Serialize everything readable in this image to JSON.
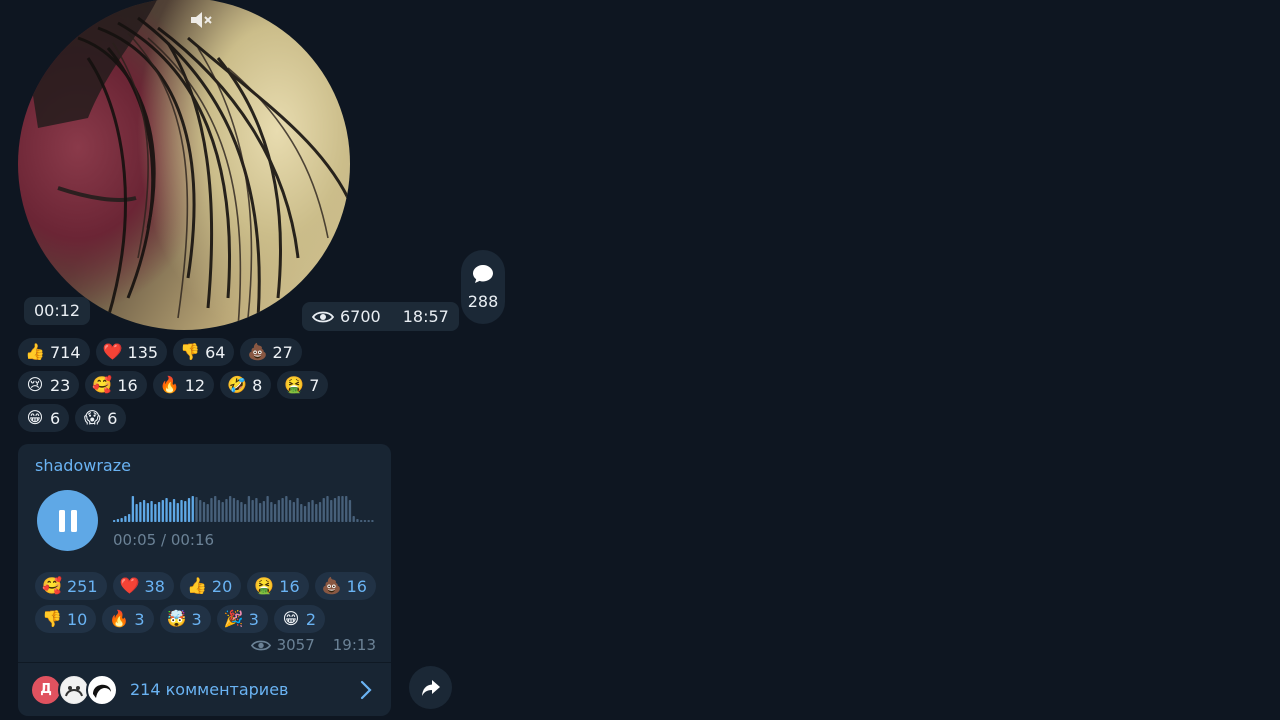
{
  "video_message": {
    "duration": "00:12",
    "views": "6700",
    "time": "18:57",
    "comments_count": "288",
    "reactions": [
      [
        {
          "emoji": "👍",
          "count": "714"
        },
        {
          "emoji": "❤️",
          "count": "135"
        },
        {
          "emoji": "👎",
          "count": "64"
        },
        {
          "emoji": "💩",
          "count": "27"
        }
      ],
      [
        {
          "emoji": "😢",
          "count": "23"
        },
        {
          "emoji": "🥰",
          "count": "16"
        },
        {
          "emoji": "🔥",
          "count": "12"
        },
        {
          "emoji": "🤣",
          "count": "8"
        },
        {
          "emoji": "🤮",
          "count": "7"
        }
      ],
      [
        {
          "emoji": "😁",
          "count": "6"
        },
        {
          "emoji": "😱",
          "count": "6"
        }
      ]
    ]
  },
  "voice_message": {
    "author": "shadowraze",
    "progress_text": "00:05 / 00:16",
    "progress_fraction": 0.3125,
    "views": "3057",
    "time": "19:13",
    "reactions": [
      [
        {
          "emoji": "🥰",
          "count": "251"
        },
        {
          "emoji": "❤️",
          "count": "38"
        },
        {
          "emoji": "👍",
          "count": "20"
        },
        {
          "emoji": "🤮",
          "count": "16"
        },
        {
          "emoji": "💩",
          "count": "16"
        }
      ],
      [
        {
          "emoji": "👎",
          "count": "10"
        },
        {
          "emoji": "🔥",
          "count": "3"
        },
        {
          "emoji": "🤯",
          "count": "3"
        },
        {
          "emoji": "🎉",
          "count": "3"
        },
        {
          "emoji": "😁",
          "count": "2"
        }
      ]
    ],
    "comments": {
      "first_avatar_letter": "Д",
      "label": "214 комментариев"
    }
  },
  "colors": {
    "background": "#0e1621",
    "bubble": "#182533",
    "accent": "#6ab3f3",
    "play_button": "#5fa8e6"
  },
  "icons": [
    "mute-icon",
    "eye-icon",
    "comment-icon",
    "pause-icon",
    "chevron-right-icon",
    "share-icon"
  ]
}
